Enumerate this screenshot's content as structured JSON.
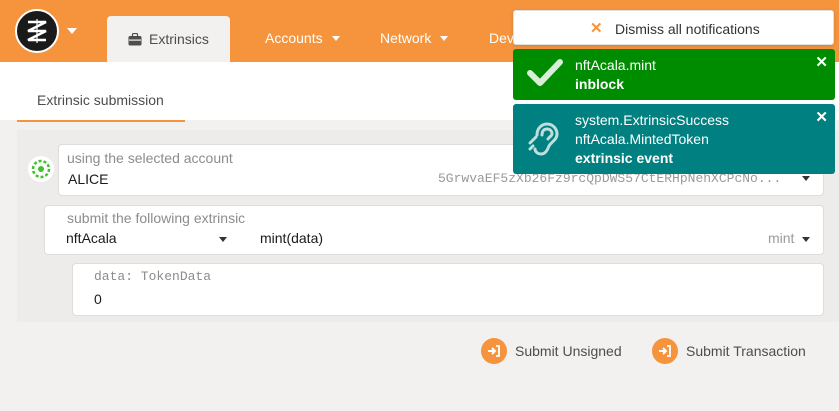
{
  "colors": {
    "accent": "#f5943d",
    "success": "#008c00",
    "event": "#008080"
  },
  "nav": {
    "active_tab": "Extrinsics",
    "active_tab_icon": "briefcase-icon",
    "items": [
      {
        "label": "Accounts"
      },
      {
        "label": "Network"
      },
      {
        "label": "Dev"
      }
    ]
  },
  "subnav": {
    "active_label": "Extrinsic submission"
  },
  "form": {
    "account": {
      "label": "using the selected account",
      "name": "ALICE",
      "address": "5GrwvaEF5zXb26Fz9rcQpDWS57CtERHpNehXCPcNo..."
    },
    "extrinsic": {
      "label": "submit the following extrinsic",
      "section": "nftAcala",
      "method": "mint(data)",
      "method_hint": "mint"
    },
    "param": {
      "label": "data: TokenData",
      "value": "0"
    }
  },
  "buttons": {
    "unsigned": "Submit Unsigned",
    "transaction": "Submit Transaction"
  },
  "notifications": {
    "dismiss_all": "Dismiss all notifications",
    "items": [
      {
        "icon": "checkmark-icon",
        "line1": "nftAcala.mint",
        "line2": "inblock"
      },
      {
        "icon": "ear-icon",
        "line1": "system.ExtrinsicSuccess",
        "line2": "nftAcala.MintedToken",
        "line3": "extrinsic event"
      }
    ]
  }
}
